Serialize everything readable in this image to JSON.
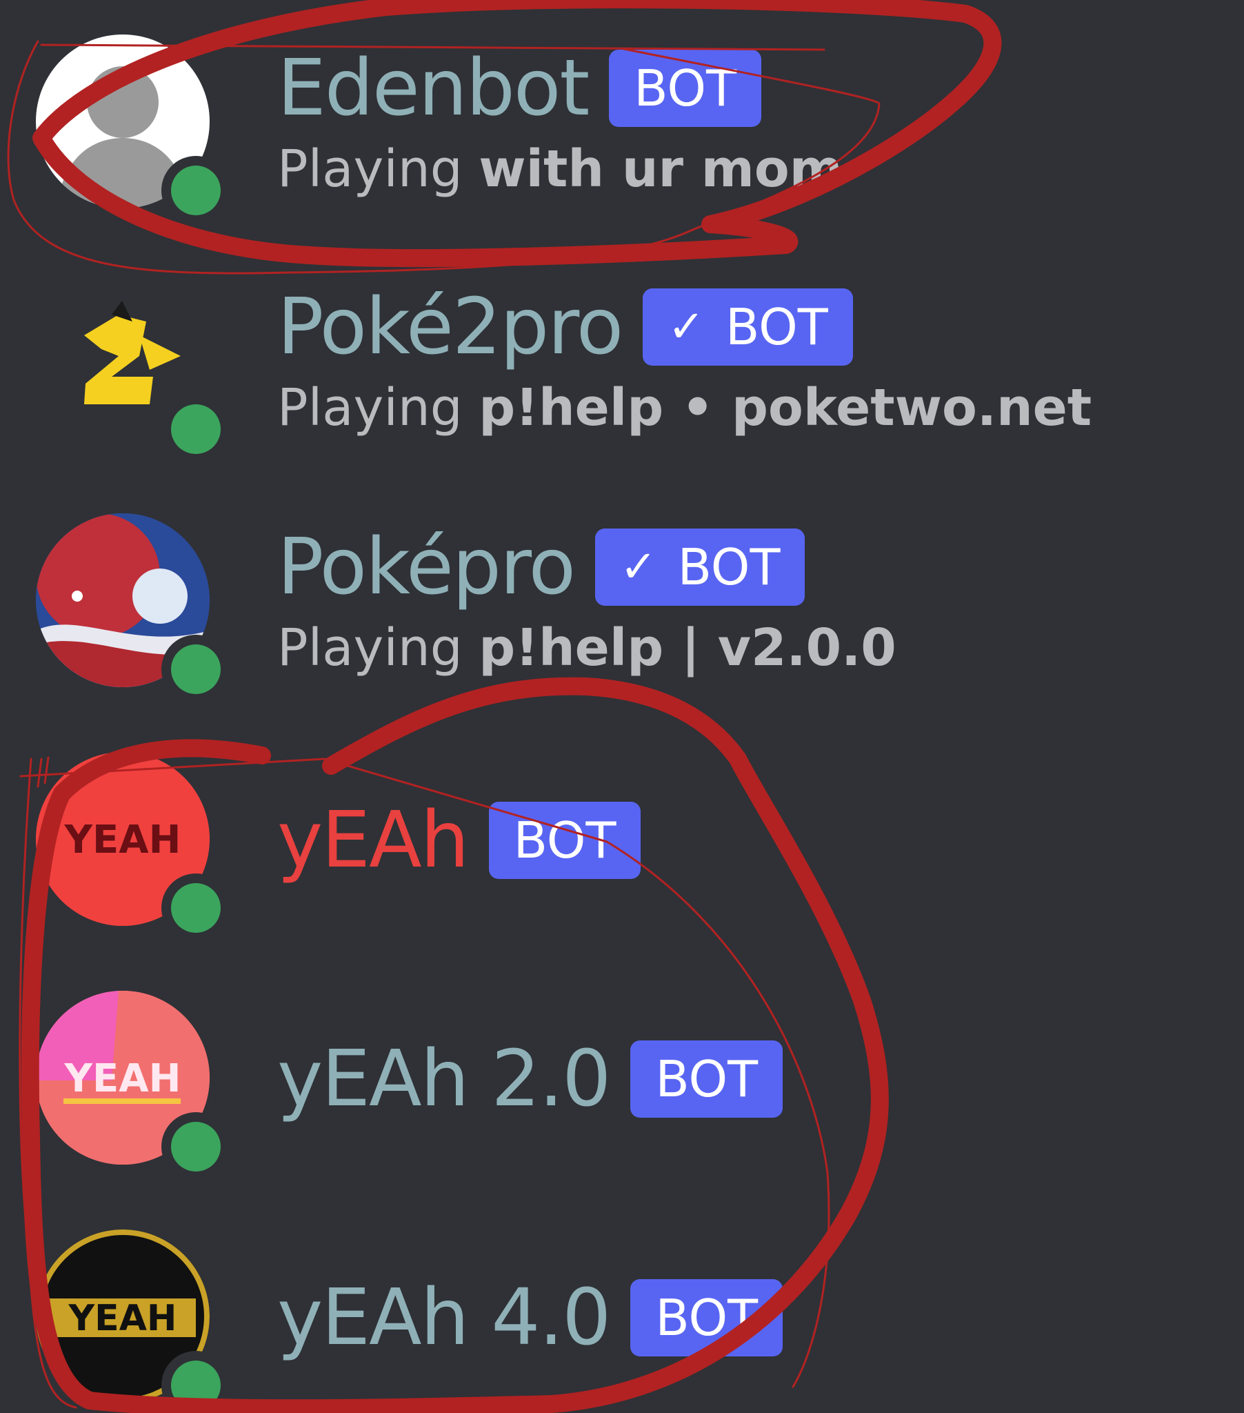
{
  "members": [
    {
      "name": "Edenbot",
      "badge": "BOT",
      "verified": false,
      "activity_prefix": "Playing ",
      "activity_detail": "with ur mom",
      "avatar": "default-user-avatar",
      "status": "online",
      "name_color": "#8fb0b7"
    },
    {
      "name": "Poké2pro",
      "badge": "BOT",
      "verified": true,
      "check": "✓",
      "activity_prefix": "Playing ",
      "activity_detail": "p!help • poketwo.net",
      "avatar": "pikachu-2-logo",
      "status": "online",
      "name_color": "#8fb0b7"
    },
    {
      "name": "Poképro",
      "badge": "BOT",
      "verified": true,
      "check": "✓",
      "activity_prefix": "Playing ",
      "activity_detail": "p!help | v2.0.0",
      "avatar": "pokeball-avatar",
      "status": "online",
      "name_color": "#8fb0b7"
    },
    {
      "name": "yEAh",
      "badge": "BOT",
      "verified": false,
      "avatar": "yeah-red-avatar",
      "avatar_text": "YEAH",
      "status": "online",
      "name_color": "#e8413f"
    },
    {
      "name": "yEAh 2.0",
      "badge": "BOT",
      "verified": false,
      "avatar": "yeah-pink-avatar",
      "avatar_text": "YEAH",
      "status": "online",
      "name_color": "#8fb0b7"
    },
    {
      "name": "yEAh 4.0",
      "badge": "BOT",
      "verified": false,
      "avatar": "yeah-black-gold-avatar",
      "avatar_text": "YEAH",
      "status": "online",
      "name_color": "#8fb0b7"
    }
  ],
  "colors": {
    "background": "#2f3136",
    "bot_badge": "#5865f2",
    "online": "#3ba55d",
    "annotation": "#b22222"
  }
}
